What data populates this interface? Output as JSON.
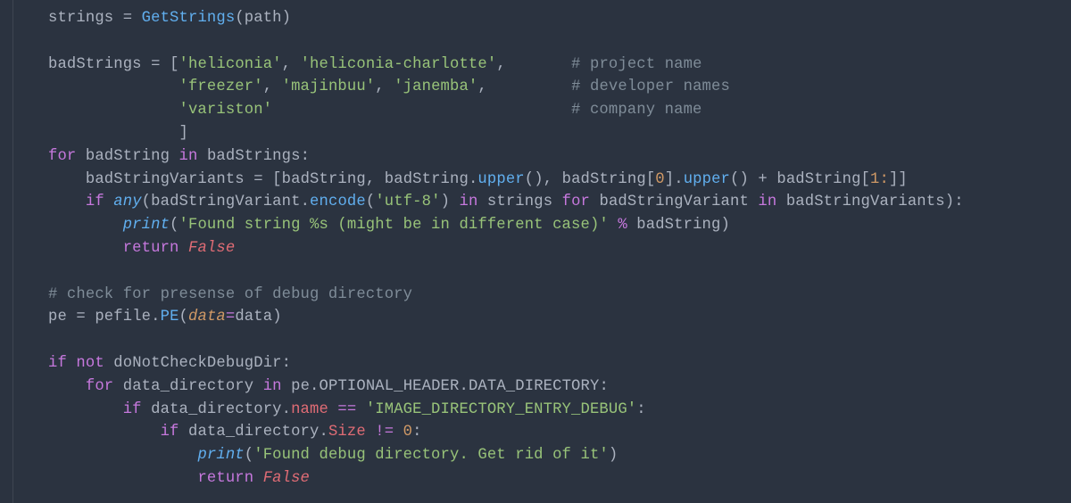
{
  "colors": {
    "background": "#2B3340",
    "default": "#ABB2BF",
    "keyword": "#C678DD",
    "call": "#61AFEF",
    "attr": "#E06C75",
    "bool": "#E06C75",
    "param": "#D19A66",
    "number": "#D19A66",
    "string": "#98C379",
    "comment": "#7F8C98"
  },
  "v": {
    "strings": "strings",
    "eq": " = ",
    "GetStrings": "GetStrings",
    "lp": "(",
    "path": "path",
    "rp": ")",
    "badStrings": "badStrings",
    "lbr": "[",
    "q_heliconia": "'heliconia'",
    "comma": ", ",
    "q_heliconia_charlotte": "'heliconia-charlotte'",
    "trailcomma": ",",
    "c_project": "# project name",
    "q_freezer": "'freezer'",
    "q_majinbuu": "'majinbuu'",
    "q_janemba": "'janemba'",
    "c_dev": "# developer names",
    "q_variston": "'variston'",
    "c_company": "# company name",
    "rbr": "]",
    "for": "for",
    "badString": "badString",
    "in": "in",
    "colon": ":",
    "badStringVariants": "badStringVariants",
    "upper": "upper",
    "lp2": "(",
    "rp2": ")",
    "lbr2": "[",
    "zero": "0",
    "rbr2": "]",
    "plus": " + ",
    "one_colon": "1:",
    "if": "if",
    "any": "any",
    "encode": "encode",
    "q_utf8": "'utf-8'",
    "badStringVariant": "badStringVariant",
    "rp3": ")",
    "print": "print",
    "q_found_str": "'Found string %s (might be in different case)'",
    "percent": " % ",
    "return": "return",
    "False": "False",
    "c_checkdbg": "# check for presense of debug directory",
    "pe": "pe",
    "pefile": "pefile",
    "PE": "PE",
    "data_kw": "data",
    "eq2": "=",
    "data_var": "data",
    "not": "not",
    "doNotCheckDebugDir": "doNotCheckDebugDir",
    "data_directory": "data_directory",
    "OPTIONAL_HEADER": "OPTIONAL_HEADER",
    "DATA_DIRECTORY": "DATA_DIRECTORY",
    "name": "name",
    "eqeq": " == ",
    "q_imgdbg": "'IMAGE_DIRECTORY_ENTRY_DEBUG'",
    "Size": "Size",
    "neq": " != ",
    "zero2": "0",
    "q_founddbg": "'Found debug directory. Get rid of it'",
    "dot": "."
  }
}
